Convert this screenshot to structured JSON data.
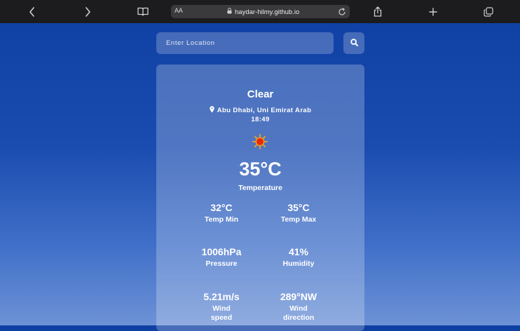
{
  "browser": {
    "url_aa": "AA",
    "url": "haydar-hilmy.github.io",
    "icons": [
      "back-icon",
      "forward-icon",
      "book-icon",
      "lock-icon",
      "reload-icon",
      "share-icon",
      "plus-icon",
      "tabs-icon"
    ]
  },
  "search": {
    "placeholder": "Enter Location",
    "button_icon": "search-icon"
  },
  "weather": {
    "condition": "Clear",
    "location": "Abu Dhabi, Uni Emirat Arab",
    "time": "18:49",
    "icon": "sun-icon",
    "temperature": "35°C",
    "temperature_label": "Temperature",
    "stats": [
      {
        "value": "32°C",
        "label": "Temp Min"
      },
      {
        "value": "35°C",
        "label": "Temp Max"
      },
      {
        "value": "1006hPa",
        "label": "Pressure"
      },
      {
        "value": "41%",
        "label": "Humidity"
      },
      {
        "value": "5.21m/s",
        "label": "Wind speed"
      },
      {
        "value": "289°NW",
        "label": "Wind direction"
      }
    ]
  },
  "colors": {
    "background_top": "#0e3fa3",
    "background_bottom": "#6d92d6",
    "toolbar": "#1c1c1e",
    "sun": "#e8280f"
  }
}
